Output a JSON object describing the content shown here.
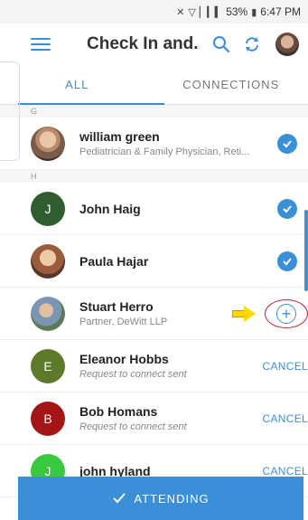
{
  "status_bar": {
    "battery": "53%",
    "time": "6:47 PM"
  },
  "app_bar": {
    "title": "Check In and..."
  },
  "tabs": [
    {
      "label": "ALL",
      "active": true
    },
    {
      "label": "CONNECTIONS",
      "active": false
    }
  ],
  "sections": [
    {
      "letter": "G",
      "rows": [
        {
          "name": "william green",
          "subtitle": "Pediatrician & Family Physician, Reti...",
          "status": "checked",
          "avatar": "photo"
        }
      ]
    },
    {
      "letter": "H",
      "rows": [
        {
          "name": "John Haig",
          "subtitle": "",
          "status": "checked",
          "initial": "J",
          "avatar_color": "#2f5d2f"
        },
        {
          "name": "Paula Hajar",
          "subtitle": "",
          "status": "checked",
          "avatar": "photo"
        },
        {
          "name": "Stuart Herro",
          "subtitle": "Partner, DeWitt LLP",
          "status": "add",
          "avatar": "photo"
        },
        {
          "name": "Eleanor Hobbs",
          "subtitle": "Request to connect sent",
          "status": "pending",
          "initial": "E",
          "avatar_color": "#5c7a2a"
        },
        {
          "name": "Bob Homans",
          "subtitle": "Request to connect sent",
          "status": "pending",
          "initial": "B",
          "avatar_color": "#a41515"
        },
        {
          "name": "john hyland",
          "subtitle": "",
          "status": "pending",
          "initial": "J",
          "avatar_color": "#39c93f"
        }
      ]
    }
  ],
  "cancel_label": "CANCEL",
  "attend_button": {
    "label": "ATTENDING"
  },
  "colors": {
    "accent": "#3b8fd9",
    "annotation_ring": "#c8203a",
    "annotation_arrow": "#ffd800"
  }
}
